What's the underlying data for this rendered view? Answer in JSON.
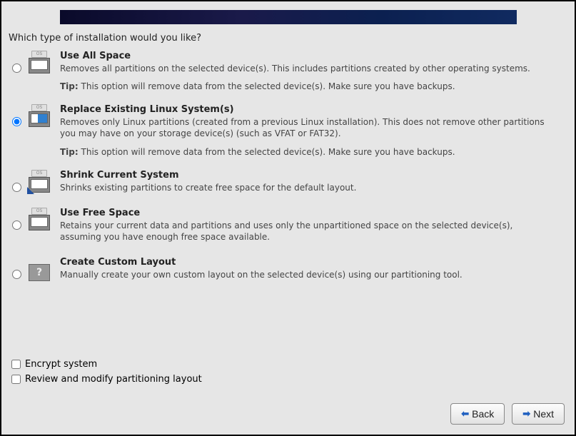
{
  "question": "Which type of installation would you like?",
  "options": {
    "use_all_space": {
      "title": "Use All Space",
      "desc": "Removes all partitions on the selected device(s).  This includes partitions created by other operating systems.",
      "tip_label": "Tip:",
      "tip_text": " This option will remove data from the selected device(s).  Make sure you have backups."
    },
    "replace_existing": {
      "title": "Replace Existing Linux System(s)",
      "desc": "Removes only Linux partitions (created from a previous Linux installation).  This does not remove other partitions you may have on your storage device(s) (such as VFAT or FAT32).",
      "tip_label": "Tip:",
      "tip_text": " This option will remove data from the selected device(s).  Make sure you have backups."
    },
    "shrink": {
      "title": "Shrink Current System",
      "desc": "Shrinks existing partitions to create free space for the default layout."
    },
    "use_free": {
      "title": "Use Free Space",
      "desc": "Retains your current data and partitions and uses only the unpartitioned space on the selected device(s), assuming you have enough free space available."
    },
    "custom": {
      "title": "Create Custom Layout",
      "desc": "Manually create your own custom layout on the selected device(s) using our partitioning tool."
    }
  },
  "selected_option": "replace_existing",
  "checkboxes": {
    "encrypt": "Encrypt system",
    "review": "Review and modify partitioning layout"
  },
  "buttons": {
    "back": "Back",
    "next": "Next"
  },
  "icon_labels": {
    "os_tab": "OS"
  }
}
